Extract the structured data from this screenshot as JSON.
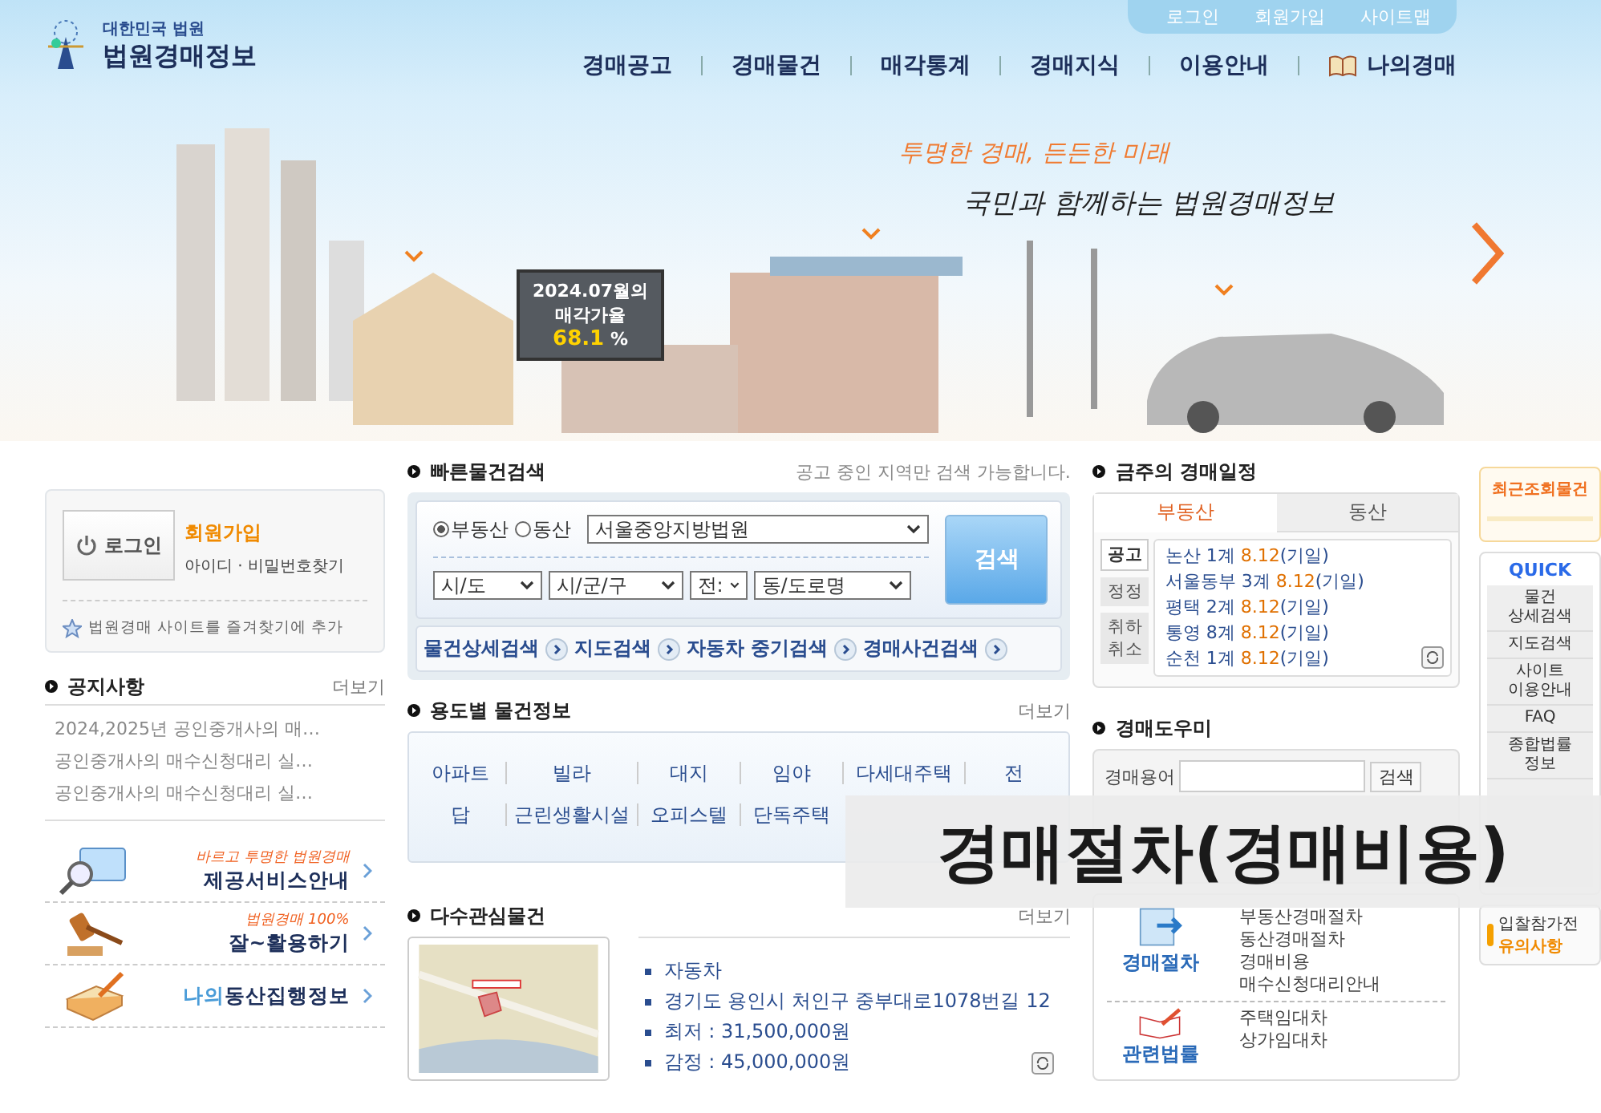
{
  "header": {
    "logo_sub": "대한민국 법원",
    "logo_title": "법원경매정보",
    "utility_links": [
      "로그인",
      "회원가입",
      "사이트맵"
    ],
    "nav": [
      {
        "label": "경매공고",
        "kind": "plain"
      },
      {
        "label": "경매물건",
        "kind": "plain"
      },
      {
        "label": "매각통계",
        "kind": "plain"
      },
      {
        "label": "경매지식",
        "kind": "plain"
      },
      {
        "label": "이용안내",
        "kind": "plain"
      },
      {
        "label": "나의경매",
        "kind": "book"
      }
    ]
  },
  "banner": {
    "slogan_1": "투명한 경매, 든든한 미래",
    "slogan_2": "국민과 함께하는 법원경매정보",
    "billboard": [
      "2024.07월의",
      "매각가율"
    ],
    "rate": "68.1",
    "rate_unit": "%"
  },
  "login_box": {
    "button": "로그인",
    "join": "회원가입",
    "find": "아이디 · 비밀번호찾기",
    "favorite": "법원경매 사이트를 즐겨찾기에 추가"
  },
  "notices": {
    "title": "공지사항",
    "more": "더보기",
    "items": [
      "2024,2025년 공인중개사의 매…",
      "공인중개사의 매수신청대리 실…",
      "공인중개사의 매수신청대리 실…"
    ]
  },
  "promos": [
    {
      "kind": "magnifier",
      "tagline": "바르고 투명한 법원경매",
      "title": "제공서비스안내"
    },
    {
      "kind": "gavel",
      "tagline": "법원경매 100%",
      "title": "잘~활용하기"
    },
    {
      "kind": "book",
      "title_lead": "나의",
      "title": "동산집행정보"
    }
  ],
  "quick_search": {
    "title": "빠른물건검색",
    "note": "공고 중인 지역만 검색 가능합니다.",
    "radios": [
      {
        "label": "부동산",
        "selected": true
      },
      {
        "label": "동산",
        "selected": false
      }
    ],
    "court": "서울중앙지방법원",
    "selects": [
      "시/도",
      "시/군/구",
      "전:",
      "동/도로명"
    ],
    "button": "검색",
    "links": [
      "물건상세검색",
      "지도검색",
      "자동차 중기검색",
      "경매사건검색"
    ]
  },
  "categories": {
    "title": "용도별 물건정보",
    "more": "더보기",
    "rows": [
      [
        "아파트",
        "빌라",
        "대지",
        "임야",
        "다세대주택",
        "전"
      ],
      [
        "답",
        "근린생활시설",
        "오피스텔",
        "단독주택"
      ]
    ]
  },
  "popular": {
    "title": "다수관심물건",
    "more": "더보기",
    "items": [
      "자동차",
      "경기도 용인시 처인구 중부대로1078번길 12",
      "최저 : 31,500,000원",
      "감정 : 45,000,000원"
    ]
  },
  "schedule": {
    "title": "금주의 경매일정",
    "tabs": [
      {
        "label": "부동산",
        "selected": true
      },
      {
        "label": "동산",
        "selected": false
      }
    ],
    "side_tabs": [
      {
        "label": "공고",
        "selected": true
      },
      {
        "label": "정정",
        "selected": false
      },
      {
        "label": "취하 취소",
        "selected": false
      }
    ],
    "items": [
      {
        "court": "논산 1계",
        "date": "8.12",
        "note": "(기일)"
      },
      {
        "court": "서울동부 3계",
        "date": "8.12",
        "note": "(기일)"
      },
      {
        "court": "평택 2계",
        "date": "8.12",
        "note": "(기일)"
      },
      {
        "court": "통영 8계",
        "date": "8.12",
        "note": "(기일)"
      },
      {
        "court": "순천 1계",
        "date": "8.12",
        "note": "(기일)"
      }
    ]
  },
  "helper": {
    "title": "경매도우미",
    "label": "경매용어",
    "button": "검색"
  },
  "guide": [
    {
      "kind": "procedure",
      "title": "경매절차",
      "links": [
        "부동산경매절차",
        "동산경매절차",
        "경매비용",
        "매수신청대리안내"
      ]
    },
    {
      "kind": "law",
      "title": "관련법률",
      "links": [
        "주택임대차",
        "상가임대차"
      ]
    }
  ],
  "sidebar": {
    "recent": "최근조회물건",
    "quick_title": "QUICK",
    "quick": [
      "물건 상세검색",
      "지도검색",
      "사이트 이용안내",
      "FAQ",
      "종합법률 정보"
    ],
    "notice_1": "입찰참가전",
    "notice_2": "유의사항"
  },
  "overlay": "경매절차(경매비용)"
}
